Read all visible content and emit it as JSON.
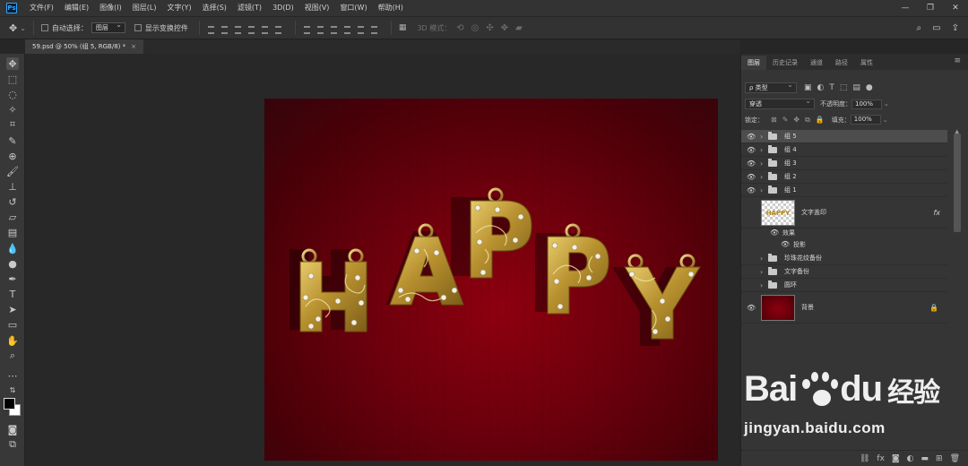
{
  "app": {
    "name": "Ps"
  },
  "menu": [
    "文件(F)",
    "编辑(E)",
    "图像(I)",
    "图层(L)",
    "文字(Y)",
    "选择(S)",
    "滤镜(T)",
    "3D(D)",
    "视图(V)",
    "窗口(W)",
    "帮助(H)"
  ],
  "window_controls": [
    "—",
    "❐",
    "✕"
  ],
  "options": {
    "auto_select_label": "自动选择：",
    "auto_select_value": "图层",
    "transform_label": "显示变换控件",
    "mode_3d_label": "3D 模式："
  },
  "document_tab": {
    "title": "59.psd @ 50% (组 5, RGB/8) *",
    "close": "×"
  },
  "canvas": {
    "text": "HAPPY"
  },
  "panel": {
    "tabs": [
      "图层",
      "历史记录",
      "通道",
      "路径",
      "属性"
    ],
    "filter_type": "ρ 类型",
    "blend_mode": "穿透",
    "opacity_label": "不透明度：",
    "opacity_value": "100%",
    "lock_label": "锁定：",
    "fill_label": "填充：",
    "fill_value": "100%"
  },
  "layers": [
    {
      "name": "组 5",
      "type": "group",
      "visible": true,
      "selected": true
    },
    {
      "name": "组 4",
      "type": "group",
      "visible": true
    },
    {
      "name": "组 3",
      "type": "group",
      "visible": true
    },
    {
      "name": "组 2",
      "type": "group",
      "visible": true
    },
    {
      "name": "组 1",
      "type": "group",
      "visible": true
    },
    {
      "name": "文字盖印",
      "type": "pixel",
      "visible": false,
      "fx": "fx",
      "thumb_text": "HAPPY"
    },
    {
      "name": "效果",
      "type": "effects"
    },
    {
      "name": "投影",
      "type": "effect"
    },
    {
      "name": "珍珠花纹备份",
      "type": "group",
      "visible": false
    },
    {
      "name": "文字备份",
      "type": "group",
      "visible": false
    },
    {
      "name": "圆环",
      "type": "group",
      "visible": false
    },
    {
      "name": "背景",
      "type": "background",
      "visible": true,
      "locked": true
    }
  ],
  "watermark": {
    "brand": "Bai",
    "brand_end": "du",
    "cn": "经验",
    "url": "jingyan.baidu.com"
  },
  "colors": {
    "gold": "#c9a642",
    "bg_red": "#7a000e",
    "accent": "#31a8ff"
  }
}
